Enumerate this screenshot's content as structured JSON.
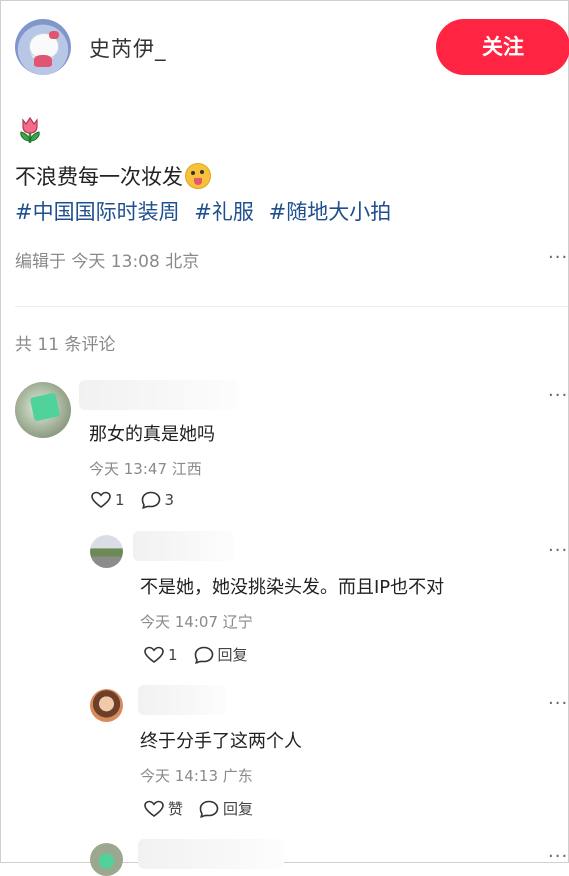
{
  "author": {
    "name": "史芮伊_",
    "follow_label": "关注"
  },
  "post": {
    "text": "不浪费每一次妆发",
    "tags": [
      "#中国国际时装周",
      "#礼服",
      "#随地大小拍"
    ],
    "edit_info": "编辑于 今天 13:08 北京",
    "more": "···"
  },
  "comments_header": "共 11 条评论",
  "comments": [
    {
      "text": "那女的真是她吗",
      "time": "今天 13:47 江西",
      "like": "1",
      "reply": "3",
      "more": "···"
    },
    {
      "text": "不是她，她没挑染头发。而且IP也不对",
      "time": "今天 14:07 辽宁",
      "like": "1",
      "reply": "回复",
      "more": "···"
    },
    {
      "text": "终于分手了这两个人",
      "time": "今天 14:13 广东",
      "like": "赞",
      "reply": "回复",
      "more": "···"
    },
    {
      "more": "···"
    }
  ],
  "colors": {
    "accent": "#ff2442",
    "tag": "#1f4f8f",
    "meta": "#8a8a8a"
  }
}
